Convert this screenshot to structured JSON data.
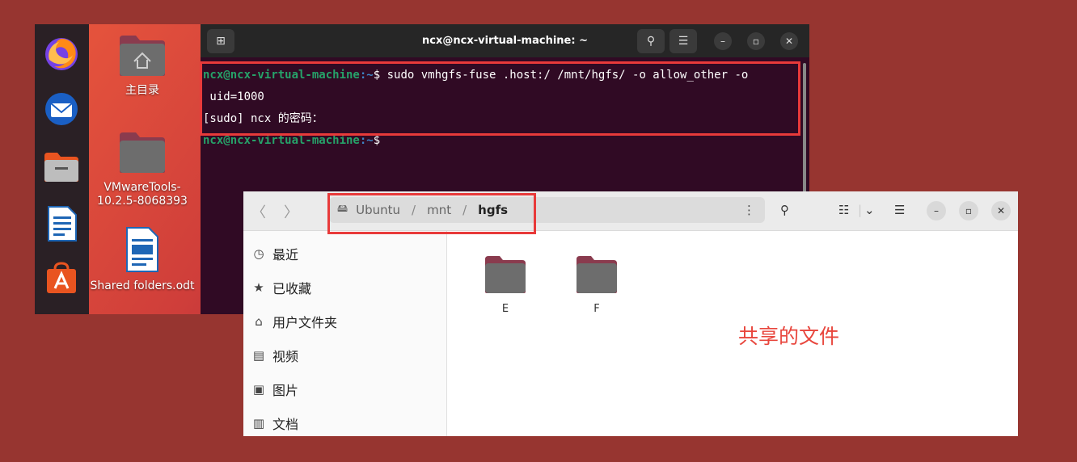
{
  "desktop": {
    "dock": [
      "firefox-icon",
      "thunderbird-icon",
      "files-icon",
      "writer-icon",
      "software-icon"
    ],
    "icons": [
      {
        "label": "主目录"
      },
      {
        "label": "VMwareTools-10.2.5-8068393"
      },
      {
        "label": "Shared folders.odt"
      }
    ]
  },
  "terminal": {
    "title": "ncx@ncx-virtual-machine: ~",
    "lines": [
      {
        "user": "ncx@ncx-virtual-machine",
        "path": ":~",
        "text": "$ sudo vmhgfs-fuse .host:/ /mnt/hgfs/ -o allow_other -o"
      },
      {
        "text": " uid=1000"
      },
      {
        "text": "[sudo] ncx 的密码："
      },
      {
        "user": "ncx@ncx-virtual-machine",
        "path": ":~",
        "text": "$ "
      }
    ]
  },
  "files": {
    "path": [
      "Ubuntu",
      "mnt",
      "hgfs"
    ],
    "sidebar": [
      "最近",
      "已收藏",
      "用户文件夹",
      "视频",
      "图片",
      "文档"
    ],
    "folders": [
      "E",
      "F"
    ],
    "annotation": "共享的文件"
  },
  "colors": {
    "background": "#973530",
    "terminal_bg": "#300a24",
    "highlight": "#e83a3a",
    "annotation": "#e8453c",
    "prompt_user": "#26a269"
  }
}
